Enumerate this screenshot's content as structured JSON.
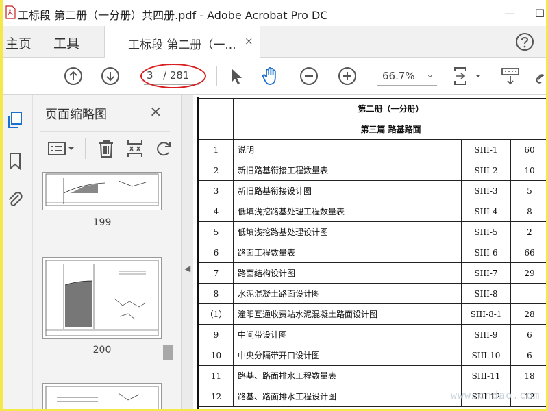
{
  "window": {
    "title": "工标段 第二册（一分册）共四册.pdf - Adobe Acrobat Pro DC",
    "minimize_glyph": "—",
    "maximize_glyph": "☐"
  },
  "tabs": {
    "home": "主页",
    "tools": "工具",
    "document": "工标段 第二册（一...",
    "close_glyph": "×"
  },
  "toolbar": {
    "current_page": "3",
    "total_pages": "/ 281",
    "zoom": "66.7%",
    "zoom_caret": "⌄",
    "highlight_color": "#d81e1e"
  },
  "thumbnails": {
    "title": "页面缩略图",
    "close_glyph": "×",
    "pages": [
      {
        "label": "199"
      },
      {
        "label": "200"
      }
    ]
  },
  "splitter": {
    "arrow": "◀"
  },
  "toc": {
    "volume_heading": "第二册（一分册）",
    "part_heading": "第三篇  路基路面",
    "rows": [
      {
        "num": "1",
        "name": "说明",
        "code": "SIII-1",
        "pages": "60"
      },
      {
        "num": "2",
        "name": "新旧路基衔接工程数量表",
        "code": "SIII-2",
        "pages": "10"
      },
      {
        "num": "3",
        "name": "新旧路基衔接设计图",
        "code": "SIII-3",
        "pages": "5"
      },
      {
        "num": "4",
        "name": "低填浅挖路基处理工程数量表",
        "code": "SIII-4",
        "pages": "8"
      },
      {
        "num": "5",
        "name": "低填浅挖路基处理设计图",
        "code": "SIII-5",
        "pages": "2"
      },
      {
        "num": "6",
        "name": "路面工程数量表",
        "code": "SIII-6",
        "pages": "66"
      },
      {
        "num": "7",
        "name": "路面结构设计图",
        "code": "SIII-7",
        "pages": "29"
      },
      {
        "num": "8",
        "name": "水泥混凝土路面设计图",
        "code": "SIII-8",
        "pages": ""
      },
      {
        "num": "（1）",
        "name": "潼阳互通收费站水泥混凝土路面设计图",
        "code": "SIII-8-1",
        "pages": "28"
      },
      {
        "num": "9",
        "name": "中间带设计图",
        "code": "SIII-9",
        "pages": "6"
      },
      {
        "num": "10",
        "name": "中央分隔带开口设计图",
        "code": "SIII-10",
        "pages": "6"
      },
      {
        "num": "11",
        "name": "路基、路面排水工程数量表",
        "code": "SIII-11",
        "pages": "18"
      },
      {
        "num": "12",
        "name": "路基、路面排水工程设计图",
        "code": "SIII-12",
        "pages": "12"
      }
    ]
  },
  "watermark": "www.cndao.com"
}
